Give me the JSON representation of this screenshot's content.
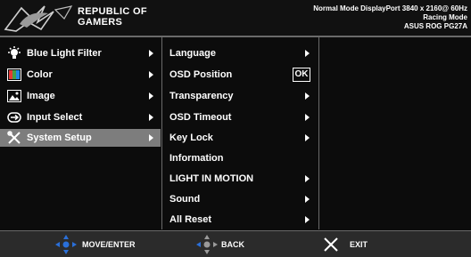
{
  "header": {
    "brand_line1": "REPUBLIC OF",
    "brand_line2": "GAMERS",
    "status_line1": "Normal Mode DisplayPort 3840 x 2160@ 60Hz",
    "status_line2": "Racing Mode",
    "status_line3": "ASUS ROG PG27A"
  },
  "main_menu": [
    {
      "label": "Blue Light Filter",
      "icon": "bulb-icon"
    },
    {
      "label": "Color",
      "icon": "color-icon"
    },
    {
      "label": "Image",
      "icon": "image-icon"
    },
    {
      "label": "Input Select",
      "icon": "input-icon"
    },
    {
      "label": "System Setup",
      "icon": "wrench-icon",
      "selected": true
    }
  ],
  "sub_menu": [
    {
      "label": "Language"
    },
    {
      "label": "OSD Position",
      "ok_label": "OK"
    },
    {
      "label": "Transparency"
    },
    {
      "label": "OSD Timeout"
    },
    {
      "label": "Key Lock"
    },
    {
      "label": "Information"
    },
    {
      "label": "LIGHT IN MOTION"
    },
    {
      "label": "Sound"
    },
    {
      "label": "All Reset"
    }
  ],
  "footer": {
    "move_label": "MOVE/ENTER",
    "back_label": "BACK",
    "exit_label": "EXIT"
  },
  "colors": {
    "nav_blue": "#2a6fd8",
    "selected_bg": "#7d7d7d"
  }
}
